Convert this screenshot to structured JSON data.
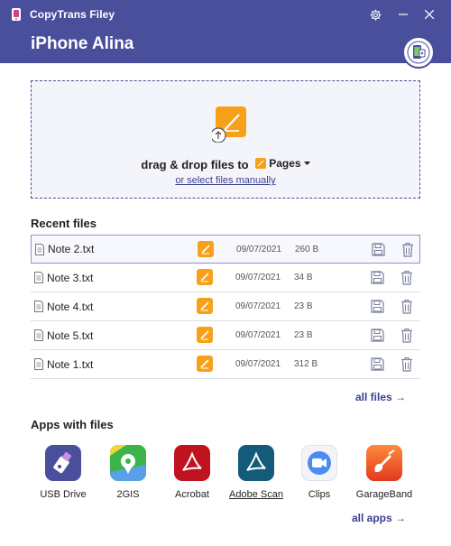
{
  "window": {
    "title": "CopyTrans Filey",
    "settings_icon": "gear-icon",
    "minimize_icon": "minimize-icon",
    "close_icon": "close-icon"
  },
  "device": {
    "name": "iPhone Alina",
    "badge_icon": "iphone-badge-icon"
  },
  "dropzone": {
    "text": "drag & drop files to",
    "target_app": "Pages",
    "link": "or select files manually",
    "icon": "upload-pages-icon"
  },
  "recent": {
    "title": "Recent files",
    "files": [
      {
        "name": "Note 2.txt",
        "date": "09/07/2021",
        "size": "260 B",
        "selected": true
      },
      {
        "name": "Note 3.txt",
        "date": "09/07/2021",
        "size": "34 B"
      },
      {
        "name": "Note 4.txt",
        "date": "09/07/2021",
        "size": "23 B"
      },
      {
        "name": "Note 5.txt",
        "date": "09/07/2021",
        "size": "23 B"
      },
      {
        "name": "Note 1.txt",
        "date": "09/07/2021",
        "size": "312 B"
      }
    ],
    "all_files_link": "all files →"
  },
  "apps": {
    "title": "Apps with files",
    "items": [
      {
        "label": "USB Drive",
        "icon": "usb-drive-icon"
      },
      {
        "label": "2GIS",
        "icon": "2gis-icon"
      },
      {
        "label": "Acrobat",
        "icon": "acrobat-icon"
      },
      {
        "label": "Adobe Scan",
        "icon": "adobe-scan-icon"
      },
      {
        "label": "Clips",
        "icon": "clips-icon"
      },
      {
        "label": "GarageBand",
        "icon": "garageband-icon"
      }
    ],
    "all_apps_link": "all apps →"
  },
  "colors": {
    "header": "#4a4f9c",
    "pages_orange": "#f7a11a",
    "link": "#3b3f8f"
  }
}
